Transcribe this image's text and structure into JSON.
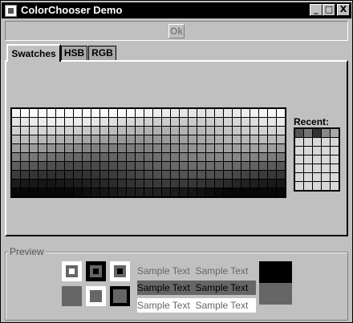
{
  "window": {
    "title": "ColorChooser Demo",
    "controls": {
      "minimize": "_",
      "maximize": "□",
      "close": "X"
    }
  },
  "toolbar": {
    "ok_label": "Ok"
  },
  "tabs": [
    {
      "label": "Swatches",
      "active": true
    },
    {
      "label": "HSB",
      "active": false
    },
    {
      "label": "RGB",
      "active": false
    }
  ],
  "swatches": {
    "recent_label": "Recent:"
  },
  "preview": {
    "label": "Preview",
    "sample_text": "Sample Text"
  },
  "colors": {
    "frame_bg": "#c0c0c0",
    "title_bar": "#000000",
    "preview_fg": "#000000",
    "preview_bg": "#666666"
  }
}
